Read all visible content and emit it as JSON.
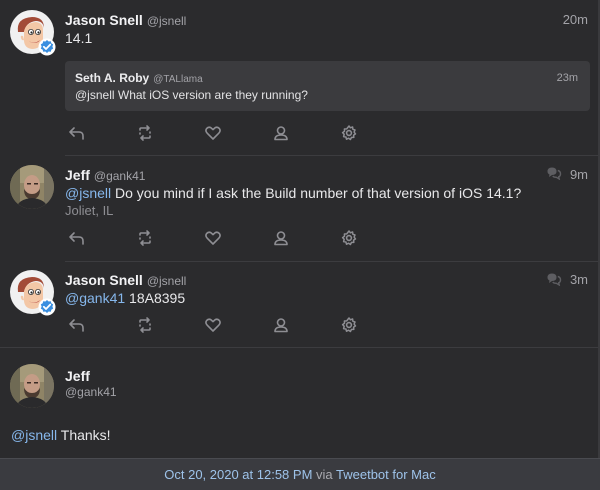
{
  "tweets": [
    {
      "name": "Jason Snell",
      "handle": "@jsnell",
      "time": "20m",
      "text": "14.1",
      "quote": {
        "name": "Seth A. Roby",
        "handle": "@TALlama",
        "time": "23m",
        "text": "@jsnell What iOS version are they running?"
      }
    },
    {
      "name": "Jeff",
      "handle": "@gank41",
      "time": "9m",
      "mention": "@jsnell",
      "text": " Do you mind if I ask the Build number of that version of iOS 14.1?",
      "location": "Joliet, IL"
    },
    {
      "name": "Jason Snell",
      "handle": "@jsnell",
      "time": "3m",
      "mention": "@gank41",
      "text": " 18A8395"
    }
  ],
  "focused": {
    "name": "Jeff",
    "handle": "@gank41",
    "mention": "@jsnell",
    "text": " Thanks!"
  },
  "footer": {
    "date": "Oct 20, 2020 at 12:58 PM",
    "via": " via ",
    "client": "Tweetbot for Mac"
  },
  "icons": [
    "reply-icon",
    "retweet-icon",
    "like-icon",
    "profile-icon",
    "settings-icon",
    "conversation-icon",
    "verified-icon"
  ],
  "colors": {
    "background": "#2b2b2d",
    "link": "#86b7ec",
    "quote_bg": "#3b3b3e",
    "footer_bg": "#3a3b40"
  }
}
